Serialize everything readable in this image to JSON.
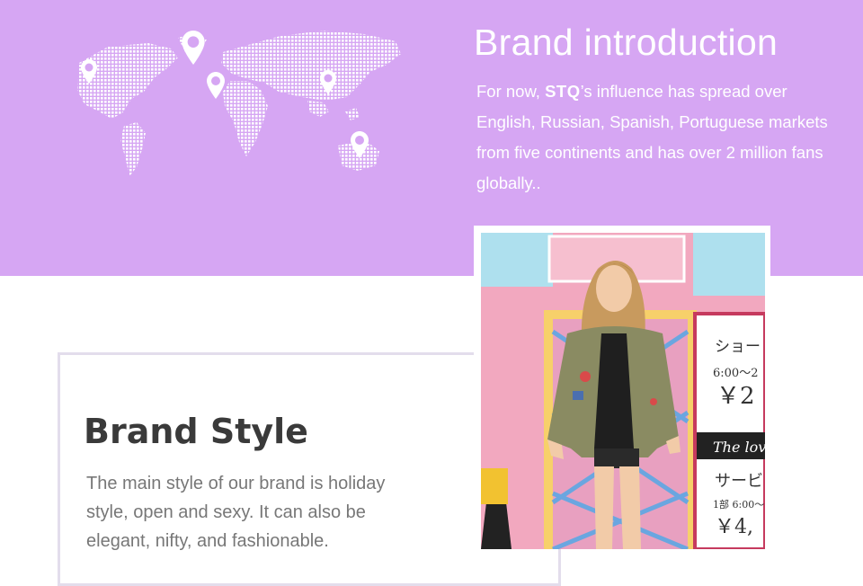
{
  "intro": {
    "title": "Brand introduction",
    "body_prefix": "For now,",
    "brand": "STQ",
    "body_rest": "’s influence has spread over English, Russian, Spanish, Portuguese markets from five continents and has over 2 million fans globally.."
  },
  "style": {
    "title": "Brand Style",
    "body": "The main style of our brand is holiday style, open and sexy. It can also be elegant, nifty, and fashionable."
  },
  "photo": {
    "sign_line1": "ショー",
    "sign_line2": "6:00～2",
    "sign_price1": "￥2",
    "sign_banner": "The lov",
    "sign_line3": "サービ",
    "sign_line4": "1部 6:00～",
    "sign_price2": "￥4,"
  },
  "colors": {
    "banner": "#d6a6f3",
    "title_dark": "#3a3a3a",
    "body_gray": "#777777"
  },
  "icons": [
    "map-pin-icon"
  ]
}
